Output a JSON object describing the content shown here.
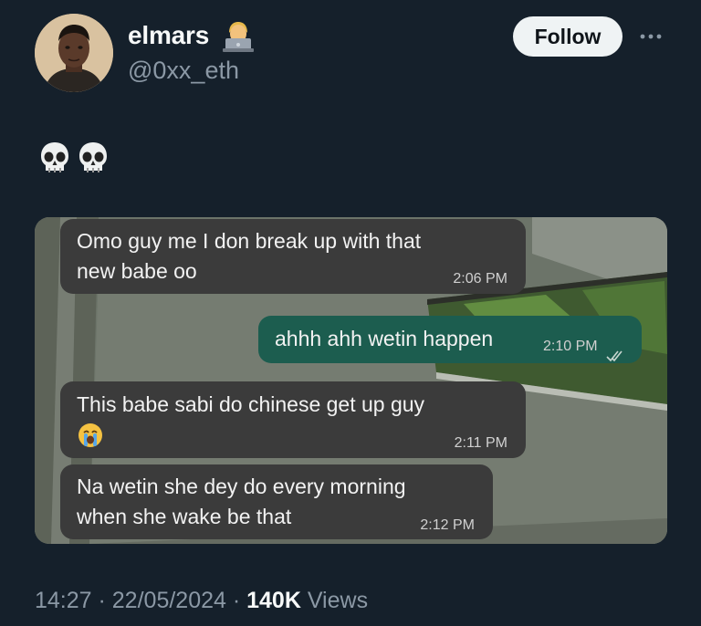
{
  "user": {
    "display_name": "elmars",
    "name_emoji": "technologist-emoji",
    "handle": "@0xx_eth",
    "avatar": "profile-photo"
  },
  "actions": {
    "follow_label": "Follow",
    "more_icon": "ellipsis-icon"
  },
  "post": {
    "text_emojis": [
      "skull-emoji",
      "skull-emoji"
    ],
    "media": {
      "type": "chat-screenshot",
      "messages": [
        {
          "direction": "incoming",
          "lines": [
            "Omo guy me I don break up with that",
            "new babe oo"
          ],
          "time": "2:06 PM"
        },
        {
          "direction": "outgoing",
          "lines": [
            "ahhh ahh wetin happen"
          ],
          "time": "2:10 PM",
          "status_icon": "double-check-icon"
        },
        {
          "direction": "incoming",
          "lines": [
            "This babe sabi do chinese get up guy"
          ],
          "emoji": "loudly-crying-face-emoji",
          "time": "2:11 PM"
        },
        {
          "direction": "incoming",
          "lines": [
            "Na wetin she dey do every morning",
            "when she wake be that"
          ],
          "time": "2:12 PM"
        }
      ]
    }
  },
  "meta": {
    "time": "14:27",
    "separator": " · ",
    "date": "22/05/2024",
    "views_count": "140K",
    "views_label": " Views"
  },
  "colors": {
    "background": "#15202b",
    "text_primary": "#f7f9f9",
    "text_secondary": "#8b98a5",
    "follow_bg": "#eff3f4",
    "bubble_incoming": "#3b3b3b",
    "bubble_outgoing": "#1c5d4f"
  }
}
